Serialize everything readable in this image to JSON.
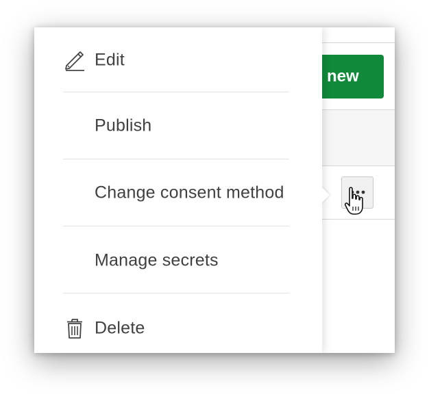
{
  "background_app": {
    "new_button_label": "new"
  },
  "context_menu": {
    "items": [
      {
        "label": "Edit",
        "icon": "pencil-icon"
      },
      {
        "label": "Publish",
        "icon": ""
      },
      {
        "label": "Change consent method",
        "icon": ""
      },
      {
        "label": "Manage secrets",
        "icon": ""
      },
      {
        "label": "Delete",
        "icon": "trash-icon"
      }
    ]
  },
  "colors": {
    "primary_green": "#108a3a",
    "menu_text": "#404040",
    "divider": "#e2e2e2"
  }
}
